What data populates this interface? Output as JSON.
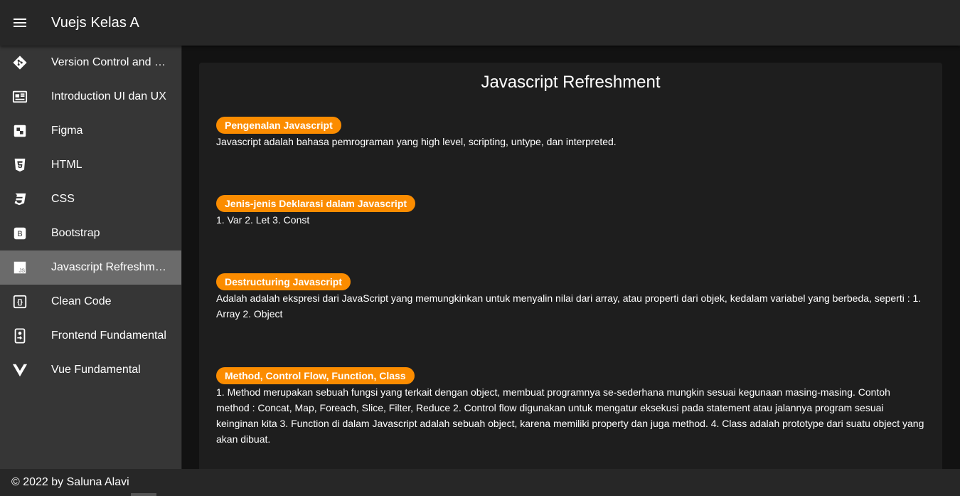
{
  "app_bar": {
    "title": "Vuejs Kelas A",
    "menu_icon": "hamburger-menu-icon"
  },
  "sidebar": {
    "items": [
      {
        "label": "Version Control and Branch Management",
        "icon": "git-icon",
        "active": false
      },
      {
        "label": "Introduction UI dan UX",
        "icon": "newspaper-icon",
        "active": false
      },
      {
        "label": "Figma",
        "icon": "figma-icon",
        "active": false
      },
      {
        "label": "HTML",
        "icon": "html5-icon",
        "active": false
      },
      {
        "label": "CSS",
        "icon": "css3-icon",
        "active": false
      },
      {
        "label": "Bootstrap",
        "icon": "bootstrap-icon",
        "active": false
      },
      {
        "label": "Javascript Refreshment",
        "icon": "javascript-icon",
        "active": true
      },
      {
        "label": "Clean Code",
        "icon": "code-braces-icon",
        "active": false
      },
      {
        "label": "Frontend Fundamental",
        "icon": "cellphone-link-icon",
        "active": false
      },
      {
        "label": "Vue Fundamental",
        "icon": "vuejs-icon",
        "active": false
      }
    ]
  },
  "main": {
    "title": "Javascript Refreshment",
    "sections": [
      {
        "chip": "Pengenalan Javascript",
        "text": "Javascript adalah bahasa pemrograman yang high level, scripting, untype, dan interpreted."
      },
      {
        "chip": "Jenis-jenis Deklarasi dalam Javascript",
        "text": "1. Var 2. Let 3. Const"
      },
      {
        "chip": "Destructuring Javascript",
        "text": "Adalah adalah ekspresi dari JavaScript yang memungkinkan untuk menyalin nilai dari array, atau properti dari objek, kedalam variabel yang berbeda, seperti : 1. Array 2. Object"
      },
      {
        "chip": "Method, Control Flow, Function, Class",
        "text": "1. Method merupakan sebuah fungsi yang terkait dengan object, membuat programnya se-sederhana mungkin sesuai kegunaan masing-masing. Contoh method : Concat, Map, Foreach, Slice, Filter, Reduce 2. Control flow digunakan untuk mengatur eksekusi pada statement atau jalannya program sesuai keinginan kita 3. Function di dalam Javascript adalah sebuah object, karena memiliki property dan juga method. 4. Class adalah prototype dari suatu object yang akan dibuat."
      }
    ]
  },
  "footer": {
    "text": "© 2022 by Saluna Alavi"
  },
  "colors": {
    "accent_chip": "#fb8c00",
    "app_bar": "#272727",
    "drawer": "#363636",
    "active_item": "#6b6b6b",
    "card": "#1e1e1e"
  }
}
